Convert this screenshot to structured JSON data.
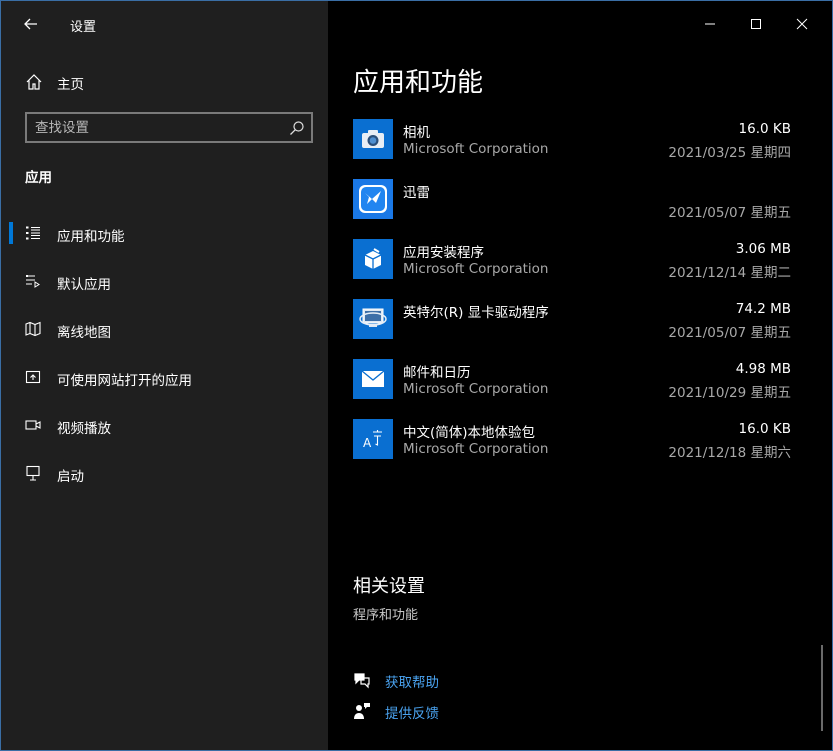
{
  "window": {
    "title": "设置",
    "accent": "#0078d7",
    "controls": [
      "minimize-icon",
      "maximize-icon",
      "close-icon"
    ]
  },
  "sidebar": {
    "home_label": "主页",
    "search_placeholder": "查找设置",
    "section": "应用",
    "items": [
      {
        "label": "应用和功能",
        "icon": "apps-list-icon",
        "active": true
      },
      {
        "label": "默认应用",
        "icon": "default-apps-icon",
        "active": false
      },
      {
        "label": "离线地图",
        "icon": "map-icon",
        "active": false
      },
      {
        "label": "可使用网站打开的应用",
        "icon": "open-with-icon",
        "active": false
      },
      {
        "label": "视频播放",
        "icon": "video-icon",
        "active": false
      },
      {
        "label": "启动",
        "icon": "startup-icon",
        "active": false
      }
    ]
  },
  "main": {
    "title": "应用和功能",
    "apps": [
      {
        "name": "相机",
        "publisher": "Microsoft Corporation",
        "size": "16.0 KB",
        "date": "2021/03/25 星期四",
        "icon": "camera-icon"
      },
      {
        "name": "迅雷",
        "publisher": "",
        "size": "",
        "date": "2021/05/07 星期五",
        "icon": "thunder-bird-icon"
      },
      {
        "name": "应用安装程序",
        "publisher": "Microsoft Corporation",
        "size": "3.06 MB",
        "date": "2021/12/14 星期二",
        "icon": "package-icon"
      },
      {
        "name": "英特尔(R) 显卡驱动程序",
        "publisher": "",
        "size": "74.2 MB",
        "date": "2021/05/07 星期五",
        "icon": "display-driver-icon"
      },
      {
        "name": "邮件和日历",
        "publisher": "Microsoft Corporation",
        "size": "4.98 MB",
        "date": "2021/10/29 星期五",
        "icon": "mail-icon"
      },
      {
        "name": "中文(简体)本地体验包",
        "publisher": "Microsoft Corporation",
        "size": "16.0 KB",
        "date": "2021/12/18 星期六",
        "icon": "language-icon"
      }
    ],
    "related": {
      "title": "相关设置",
      "link": "程序和功能"
    },
    "help": {
      "get_help": "获取帮助",
      "feedback": "提供反馈"
    }
  }
}
